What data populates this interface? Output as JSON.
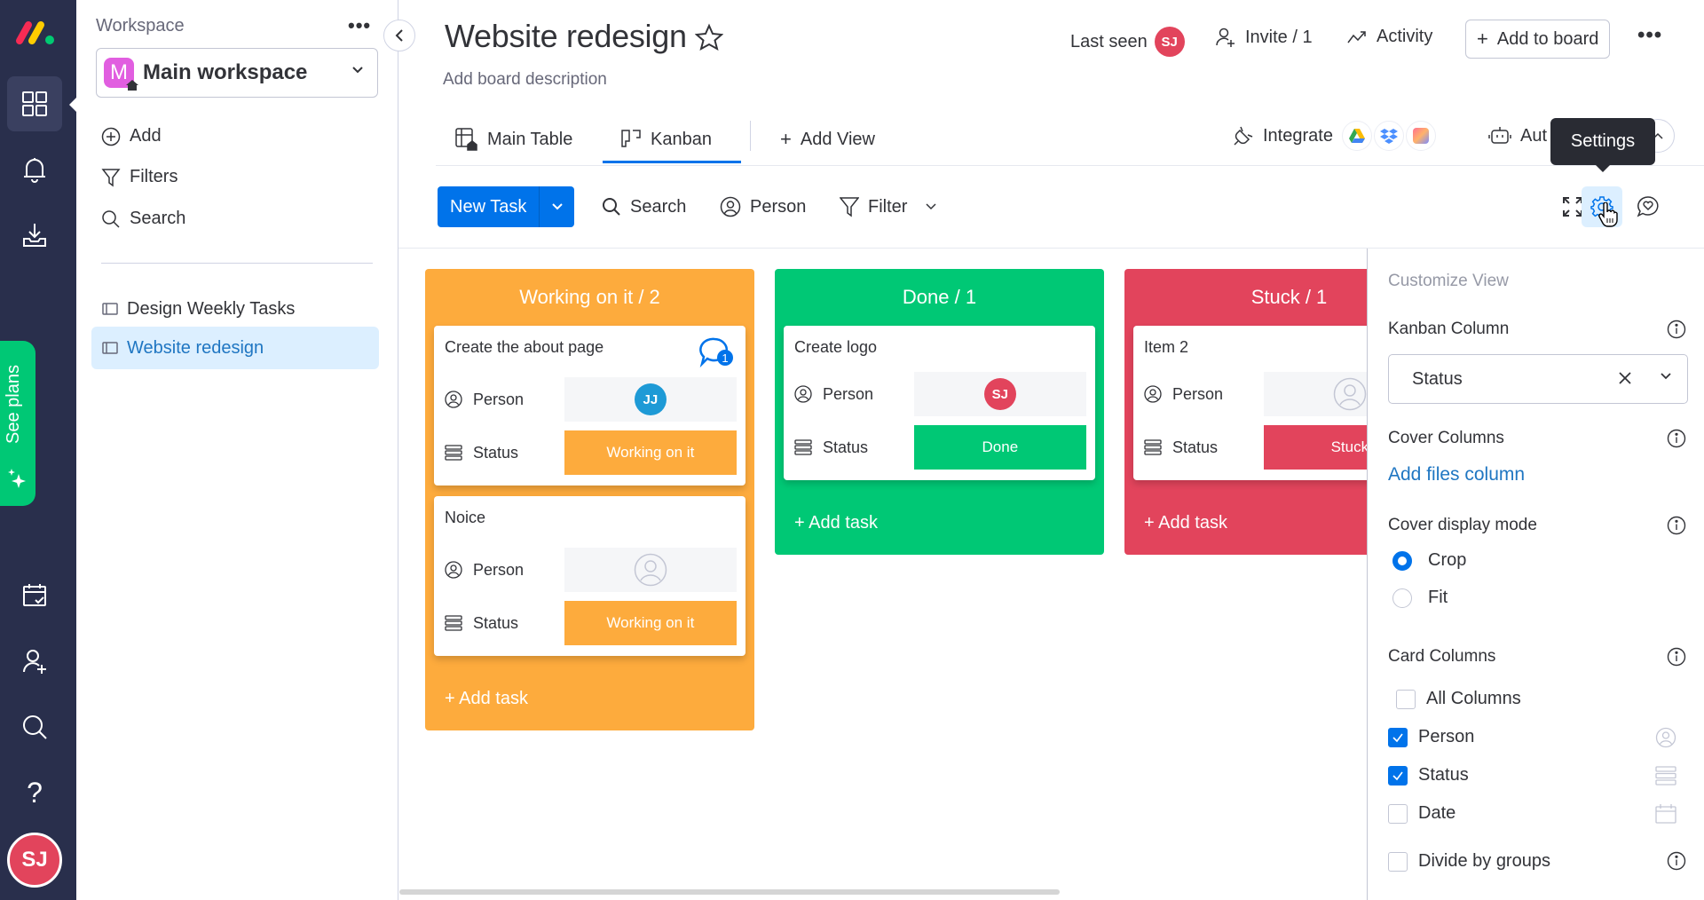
{
  "rail": {
    "logo": "monday-logo",
    "items": [
      {
        "name": "workspaces",
        "icon": "grid-icon",
        "active": true
      },
      {
        "name": "notifications",
        "icon": "bell-icon"
      },
      {
        "name": "inbox",
        "icon": "inbox-download-icon"
      },
      {
        "name": "my-work",
        "icon": "calendar-check-icon"
      },
      {
        "name": "invite",
        "icon": "person-plus-icon"
      },
      {
        "name": "search",
        "icon": "search-icon"
      },
      {
        "name": "help",
        "icon": "question-icon"
      }
    ],
    "see_plans": "See plans",
    "user_initials": "SJ"
  },
  "sidebar": {
    "workspace_label": "Workspace",
    "workspace_name": "Main workspace",
    "workspace_initial": "M",
    "actions": [
      {
        "label": "Add",
        "icon": "plus-circle-icon"
      },
      {
        "label": "Filters",
        "icon": "filter-icon"
      },
      {
        "label": "Search",
        "icon": "search-icon"
      }
    ],
    "boards": [
      {
        "label": "Design Weekly Tasks",
        "active": false
      },
      {
        "label": "Website redesign",
        "active": true
      }
    ]
  },
  "header": {
    "title": "Website redesign",
    "description": "Add board description",
    "last_seen_label": "Last seen",
    "last_seen_initials": "SJ",
    "invite_label": "Invite / 1",
    "activity_label": "Activity",
    "add_to_board_label": "Add to board"
  },
  "tabs": {
    "items": [
      {
        "label": "Main Table",
        "active": false
      },
      {
        "label": "Kanban",
        "active": true
      }
    ],
    "add_view_label": "Add View",
    "integrate_label": "Integrate",
    "automate_label": "Automate",
    "automate_visible": "Aut"
  },
  "tooltip": "Settings",
  "toolbar": {
    "new_task_label": "New Task",
    "search_label": "Search",
    "person_label": "Person",
    "filter_label": "Filter"
  },
  "kanban": {
    "columns": [
      {
        "title": "Working on it / 2",
        "color": "#fdab3d",
        "add_label": "+ Add task",
        "cards": [
          {
            "name": "Create the about page",
            "person_label": "Person",
            "person": "JJ",
            "person_color": "#1e9ad6",
            "status_label": "Status",
            "status": "Working on it",
            "comments": "1"
          },
          {
            "name": "Noice",
            "person_label": "Person",
            "person": "",
            "status_label": "Status",
            "status": "Working on it"
          }
        ]
      },
      {
        "title": "Done / 1",
        "color": "#00c875",
        "add_label": "+ Add task",
        "cards": [
          {
            "name": "Create logo",
            "person_label": "Person",
            "person": "SJ",
            "person_color": "#e2445c",
            "status_label": "Status",
            "status": "Done"
          }
        ]
      },
      {
        "title": "Stuck / 1",
        "color": "#e2445c",
        "add_label": "+ Add task",
        "cards": [
          {
            "name": "Item 2",
            "person_label": "Person",
            "person": "",
            "status_label": "Status",
            "status": "Stuck"
          }
        ]
      }
    ]
  },
  "panel": {
    "title": "Customize View",
    "kanban_column_label": "Kanban Column",
    "kanban_column_value": "Status",
    "cover_columns_label": "Cover Columns",
    "add_files_link": "Add files column",
    "cover_mode_label": "Cover display mode",
    "cover_modes": [
      {
        "label": "Crop",
        "selected": true
      },
      {
        "label": "Fit",
        "selected": false
      }
    ],
    "card_columns_label": "Card Columns",
    "all_columns_label": "All Columns",
    "card_columns": [
      {
        "label": "Person",
        "checked": true,
        "icon": "person-icon"
      },
      {
        "label": "Status",
        "checked": true,
        "icon": "status-icon"
      },
      {
        "label": "Date",
        "checked": false,
        "icon": "calendar-icon"
      }
    ],
    "divide_by_groups_label": "Divide by groups",
    "divide_by_groups_checked": false
  },
  "colors": {
    "accent": "#0073ea",
    "rail_bg": "#292f4c",
    "working": "#fdab3d",
    "done": "#00c875",
    "stuck": "#e2445c"
  }
}
